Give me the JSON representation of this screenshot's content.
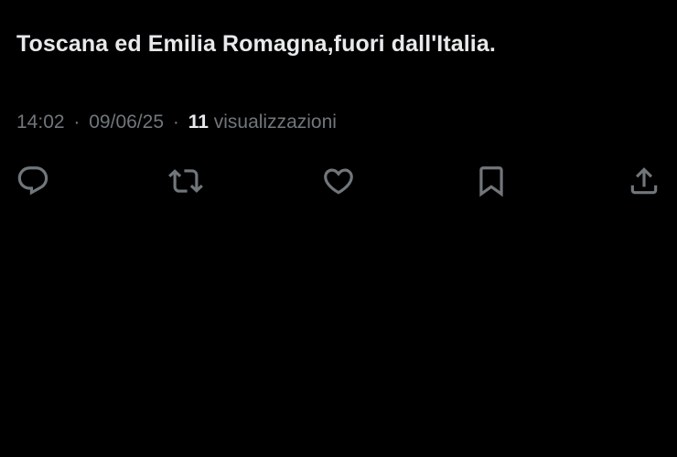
{
  "tweet": {
    "text": "Toscana ed Emilia Romagna,fuori dall'Italia.",
    "time": "14:02",
    "separator": "·",
    "date": "09/06/25",
    "views_count": "11",
    "views_label": "visualizzazioni"
  },
  "actions": [
    {
      "name": "reply",
      "icon": "reply-icon"
    },
    {
      "name": "retweet",
      "icon": "retweet-icon"
    },
    {
      "name": "like",
      "icon": "heart-icon"
    },
    {
      "name": "bookmark",
      "icon": "bookmark-icon"
    },
    {
      "name": "share",
      "icon": "share-icon"
    }
  ],
  "colors": {
    "background": "#000000",
    "text": "#e7e9ea",
    "secondary": "#71767b"
  }
}
